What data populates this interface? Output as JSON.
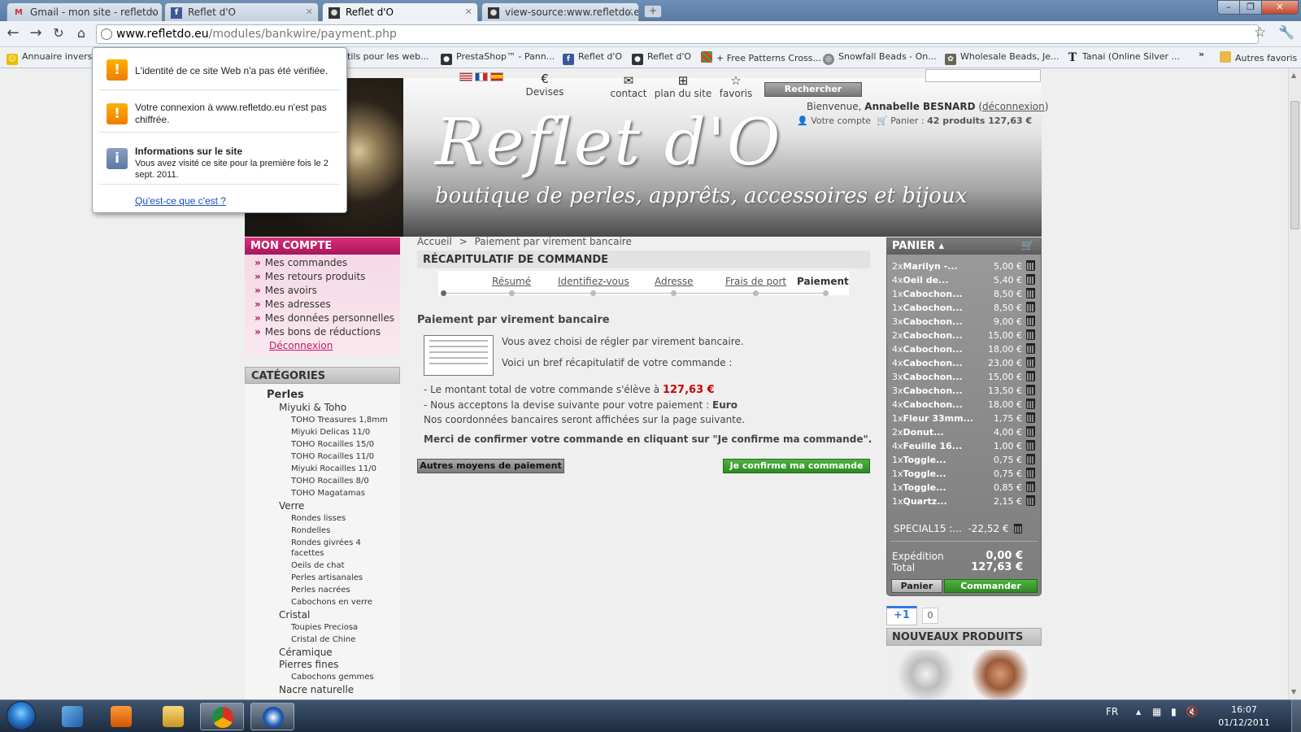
{
  "browser": {
    "tabs": [
      {
        "label": "Gmail - mon site - refletdo",
        "icon": "gmail-icon"
      },
      {
        "label": "Reflet d'O",
        "icon": "facebook-icon"
      },
      {
        "label": "Reflet d'O",
        "icon": "site-icon"
      },
      {
        "label": "view-source:www.refletdo.e",
        "icon": "site-icon"
      }
    ],
    "url_host": "www.refletdo.eu",
    "url_path": "/modules/bankwire/payment.php",
    "bookmarks": [
      "Annuaire inverse",
      "tils pour les web...",
      "PrestaShop™ - Pann...",
      "Reflet d'O",
      "Reflet d'O",
      "+ Free Patterns Cross...",
      "Snowfall Beads - On...",
      "Wholesale Beads, Je...",
      "Tanai (Online Silver ..."
    ],
    "other_bookmarks": "Autres favoris",
    "overflow": "»"
  },
  "popup": {
    "warning1": "L'identité de ce site Web n'a pas été vérifiée.",
    "warning2": "Votre connexion à www.refletdo.eu n'est pas chiffrée.",
    "info_title": "Informations sur le site",
    "info_text": "Vous avez visité ce site pour la première fois le 2 sept. 2011.",
    "link": "Qu'est-ce que c'est ?"
  },
  "header": {
    "devises": "Devises",
    "euro_symbol": "€",
    "contact": "contact",
    "plan": "plan du site",
    "favoris": "favoris",
    "search_button": "Rechercher",
    "welcome_prefix": "Bienvenue,",
    "user_name": "Annabelle BESNARD",
    "logout": "déconnexion",
    "account_label": "Votre compte",
    "cart_label": "Panier :",
    "cart_summary": "42 produits 127,63 €",
    "logo_title": "Reflet d'O",
    "logo_subtitle": "boutique de perles, apprêts, accessoires et bijoux"
  },
  "moncompte": {
    "title": "Mon compte",
    "items": [
      "Mes commandes",
      "Mes retours produits",
      "Mes avoirs",
      "Mes adresses",
      "Mes données personnelles",
      "Mes bons de réductions"
    ],
    "logout": "Déconnexion"
  },
  "categories": {
    "title": "CATÉGORIES",
    "items": [
      {
        "label": "Perles",
        "level": 1
      },
      {
        "label": "Miyuki & Toho",
        "level": 2
      },
      {
        "label": "TOHO Treasures 1,8mm",
        "level": 3
      },
      {
        "label": "Miyuki Delicas 11/0",
        "level": 3
      },
      {
        "label": "TOHO Rocailles 15/0",
        "level": 3
      },
      {
        "label": "TOHO Rocailles 11/0",
        "level": 3
      },
      {
        "label": "Miyuki Rocailles 11/0",
        "level": 3
      },
      {
        "label": "TOHO Rocailles 8/0",
        "level": 3
      },
      {
        "label": "TOHO Magatamas",
        "level": 3
      },
      {
        "label": "Verre",
        "level": 2
      },
      {
        "label": "Rondes lisses",
        "level": 3
      },
      {
        "label": "Rondelles",
        "level": 3
      },
      {
        "label": "Rondes givrées 4",
        "level": 3
      },
      {
        "label": "facettes",
        "level": 3
      },
      {
        "label": "Oeils de chat",
        "level": 3
      },
      {
        "label": "Perles artisanales",
        "level": 3
      },
      {
        "label": "Perles nacrées",
        "level": 3
      },
      {
        "label": "Cabochons en verre",
        "level": 3
      },
      {
        "label": "Cristal",
        "level": 2
      },
      {
        "label": "Toupies Preciosa",
        "level": 3
      },
      {
        "label": "Cristal de Chine",
        "level": 3
      },
      {
        "label": "Céramique",
        "level": 2
      },
      {
        "label": "Pierres fines",
        "level": 2
      },
      {
        "label": "Cabochons gemmes",
        "level": 3
      },
      {
        "label": "Nacre naturelle",
        "level": 2
      }
    ]
  },
  "main": {
    "breadcrumb_home": "Accueil",
    "breadcrumb_sep": ">",
    "breadcrumb_current": "Paiement par virement bancaire",
    "recap_title": "RÉCAPITULATIF DE COMMANDE",
    "steps": [
      "Résumé",
      "Identifiez-vous",
      "Adresse",
      "Frais de port",
      "Paiement"
    ],
    "pay_title": "Paiement par virement bancaire",
    "line1": "Vous avez choisi de régler par virement bancaire.",
    "line2": "Voici un bref récapitulatif de votre commande :",
    "total_text": "- Le montant total de votre commande s'élève à",
    "total_amount": "127,63 €",
    "currency_text": "- Nous acceptons la devise suivante pour votre paiement :",
    "currency": "Euro",
    "bank_text": "Nos coordonnées bancaires seront affichées sur la page suivante.",
    "merci": "Merci de confirmer votre commande en cliquant sur \"Je confirme ma commande\".",
    "btn_other": "Autres moyens de paiement",
    "btn_confirm": "Je confirme ma commande"
  },
  "cart": {
    "title": "PANIER",
    "items": [
      {
        "qty": "2x",
        "name": "Marilyn -...",
        "price": "5,00 €"
      },
      {
        "qty": "4x",
        "name": "Oeil de...",
        "price": "5,40 €"
      },
      {
        "qty": "1x",
        "name": "Cabochon...",
        "price": "8,50 €"
      },
      {
        "qty": "1x",
        "name": "Cabochon...",
        "price": "8,50 €"
      },
      {
        "qty": "3x",
        "name": "Cabochon...",
        "price": "9,00 €"
      },
      {
        "qty": "2x",
        "name": "Cabochon...",
        "price": "15,00 €"
      },
      {
        "qty": "4x",
        "name": "Cabochon...",
        "price": "18,00 €"
      },
      {
        "qty": "4x",
        "name": "Cabochon...",
        "price": "23,00 €"
      },
      {
        "qty": "3x",
        "name": "Cabochon...",
        "price": "15,00 €"
      },
      {
        "qty": "3x",
        "name": "Cabochon...",
        "price": "13,50 €"
      },
      {
        "qty": "4x",
        "name": "Cabochon...",
        "price": "18,00 €"
      },
      {
        "qty": "1x",
        "name": "Fleur 33mm...",
        "price": "1,75 €"
      },
      {
        "qty": "2x",
        "name": "Donut...",
        "price": "4,00 €"
      },
      {
        "qty": "4x",
        "name": "Feuille 16...",
        "price": "1,00 €"
      },
      {
        "qty": "1x",
        "name": "Toggle...",
        "price": "0,75 €"
      },
      {
        "qty": "1x",
        "name": "Toggle...",
        "price": "0,75 €"
      },
      {
        "qty": "1x",
        "name": "Toggle...",
        "price": "0,85 €"
      },
      {
        "qty": "1x",
        "name": "Quartz...",
        "price": "2,15 €"
      }
    ],
    "discount_label": "SPECIAL15 :...",
    "discount_value": "-22,52 €",
    "shipping_label": "Expédition",
    "shipping_value": "0,00 €",
    "total_label": "Total",
    "total_value": "127,63 €",
    "btn_panier": "Panier",
    "btn_commander": "Commander"
  },
  "social": {
    "plusone": "+1",
    "count": "0"
  },
  "nouveaux": {
    "title": "NOUVEAUX PRODUITS"
  },
  "taskbar": {
    "lang": "FR",
    "time": "16:07",
    "date": "01/12/2011"
  }
}
